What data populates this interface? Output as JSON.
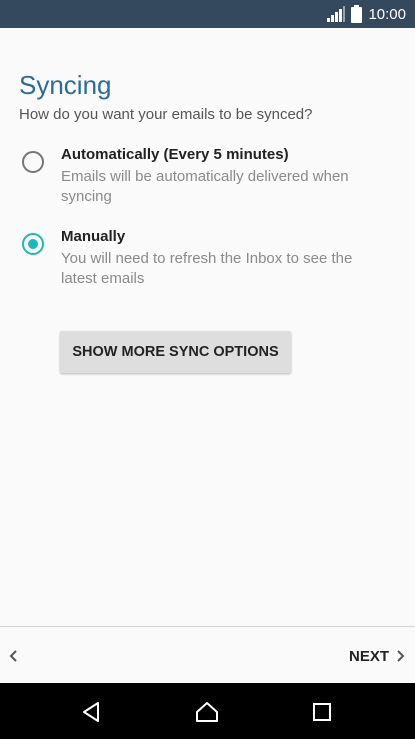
{
  "status_bar": {
    "time": "10:00",
    "icons": [
      "signal-icon",
      "battery-icon"
    ],
    "color": "#34495e"
  },
  "page": {
    "title": "Syncing",
    "subtitle": "How do you want your emails to be synced?",
    "title_color": "#2b6b96"
  },
  "sync_options": [
    {
      "title": "Automatically (Every 5 minutes)",
      "description": "Emails will be automatically delivered when syncing",
      "selected": false
    },
    {
      "title": "Manually",
      "description": "You will need to refresh the Inbox to see the latest emails",
      "selected": true
    }
  ],
  "accent_color": "#1eb8b6",
  "more_options_button": {
    "label": "SHOW MORE SYNC OPTIONS"
  },
  "bottom_nav": {
    "back_icon": "chevron-left-icon",
    "next_label": "NEXT",
    "next_icon": "chevron-right-icon"
  },
  "system_nav": {
    "icons": [
      "back-triangle-icon",
      "home-icon",
      "recent-apps-icon"
    ]
  }
}
